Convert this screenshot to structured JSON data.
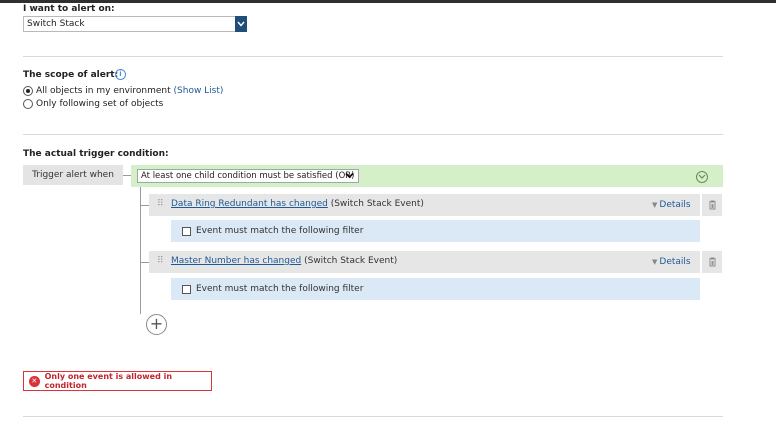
{
  "alert_on": {
    "label": "I want to alert on:",
    "selected": "Switch Stack"
  },
  "scope": {
    "label": "The scope of alert:",
    "info_icon": "info-icon",
    "options": [
      {
        "text": "All objects in my environment",
        "link": "(Show List)",
        "checked": true
      },
      {
        "text": "Only following set of objects",
        "link": "",
        "checked": false
      }
    ]
  },
  "trigger": {
    "label": "The actual trigger condition:",
    "when_label": "Trigger alert when",
    "group_condition": "At least one child condition must be satisfied (OR)",
    "conditions": [
      {
        "event_link": "Data Ring Redundant has changed",
        "event_type": "(Switch Stack Event)",
        "details_label": "Details",
        "filter_label": "Event must match the following filter",
        "filter_checked": false
      },
      {
        "event_link": "Master Number has changed",
        "event_type": "(Switch Stack Event)",
        "details_label": "Details",
        "filter_label": "Event must match the following filter",
        "filter_checked": false
      }
    ],
    "add_icon": "plus-circle-icon"
  },
  "error": {
    "message": "Only one event is allowed in condition",
    "color": "#d9343a"
  },
  "colors": {
    "accent": "#1f4e79",
    "link": "#1f5a96",
    "group_bar": "#d5f0c8",
    "filter_row": "#dbe8f6"
  }
}
